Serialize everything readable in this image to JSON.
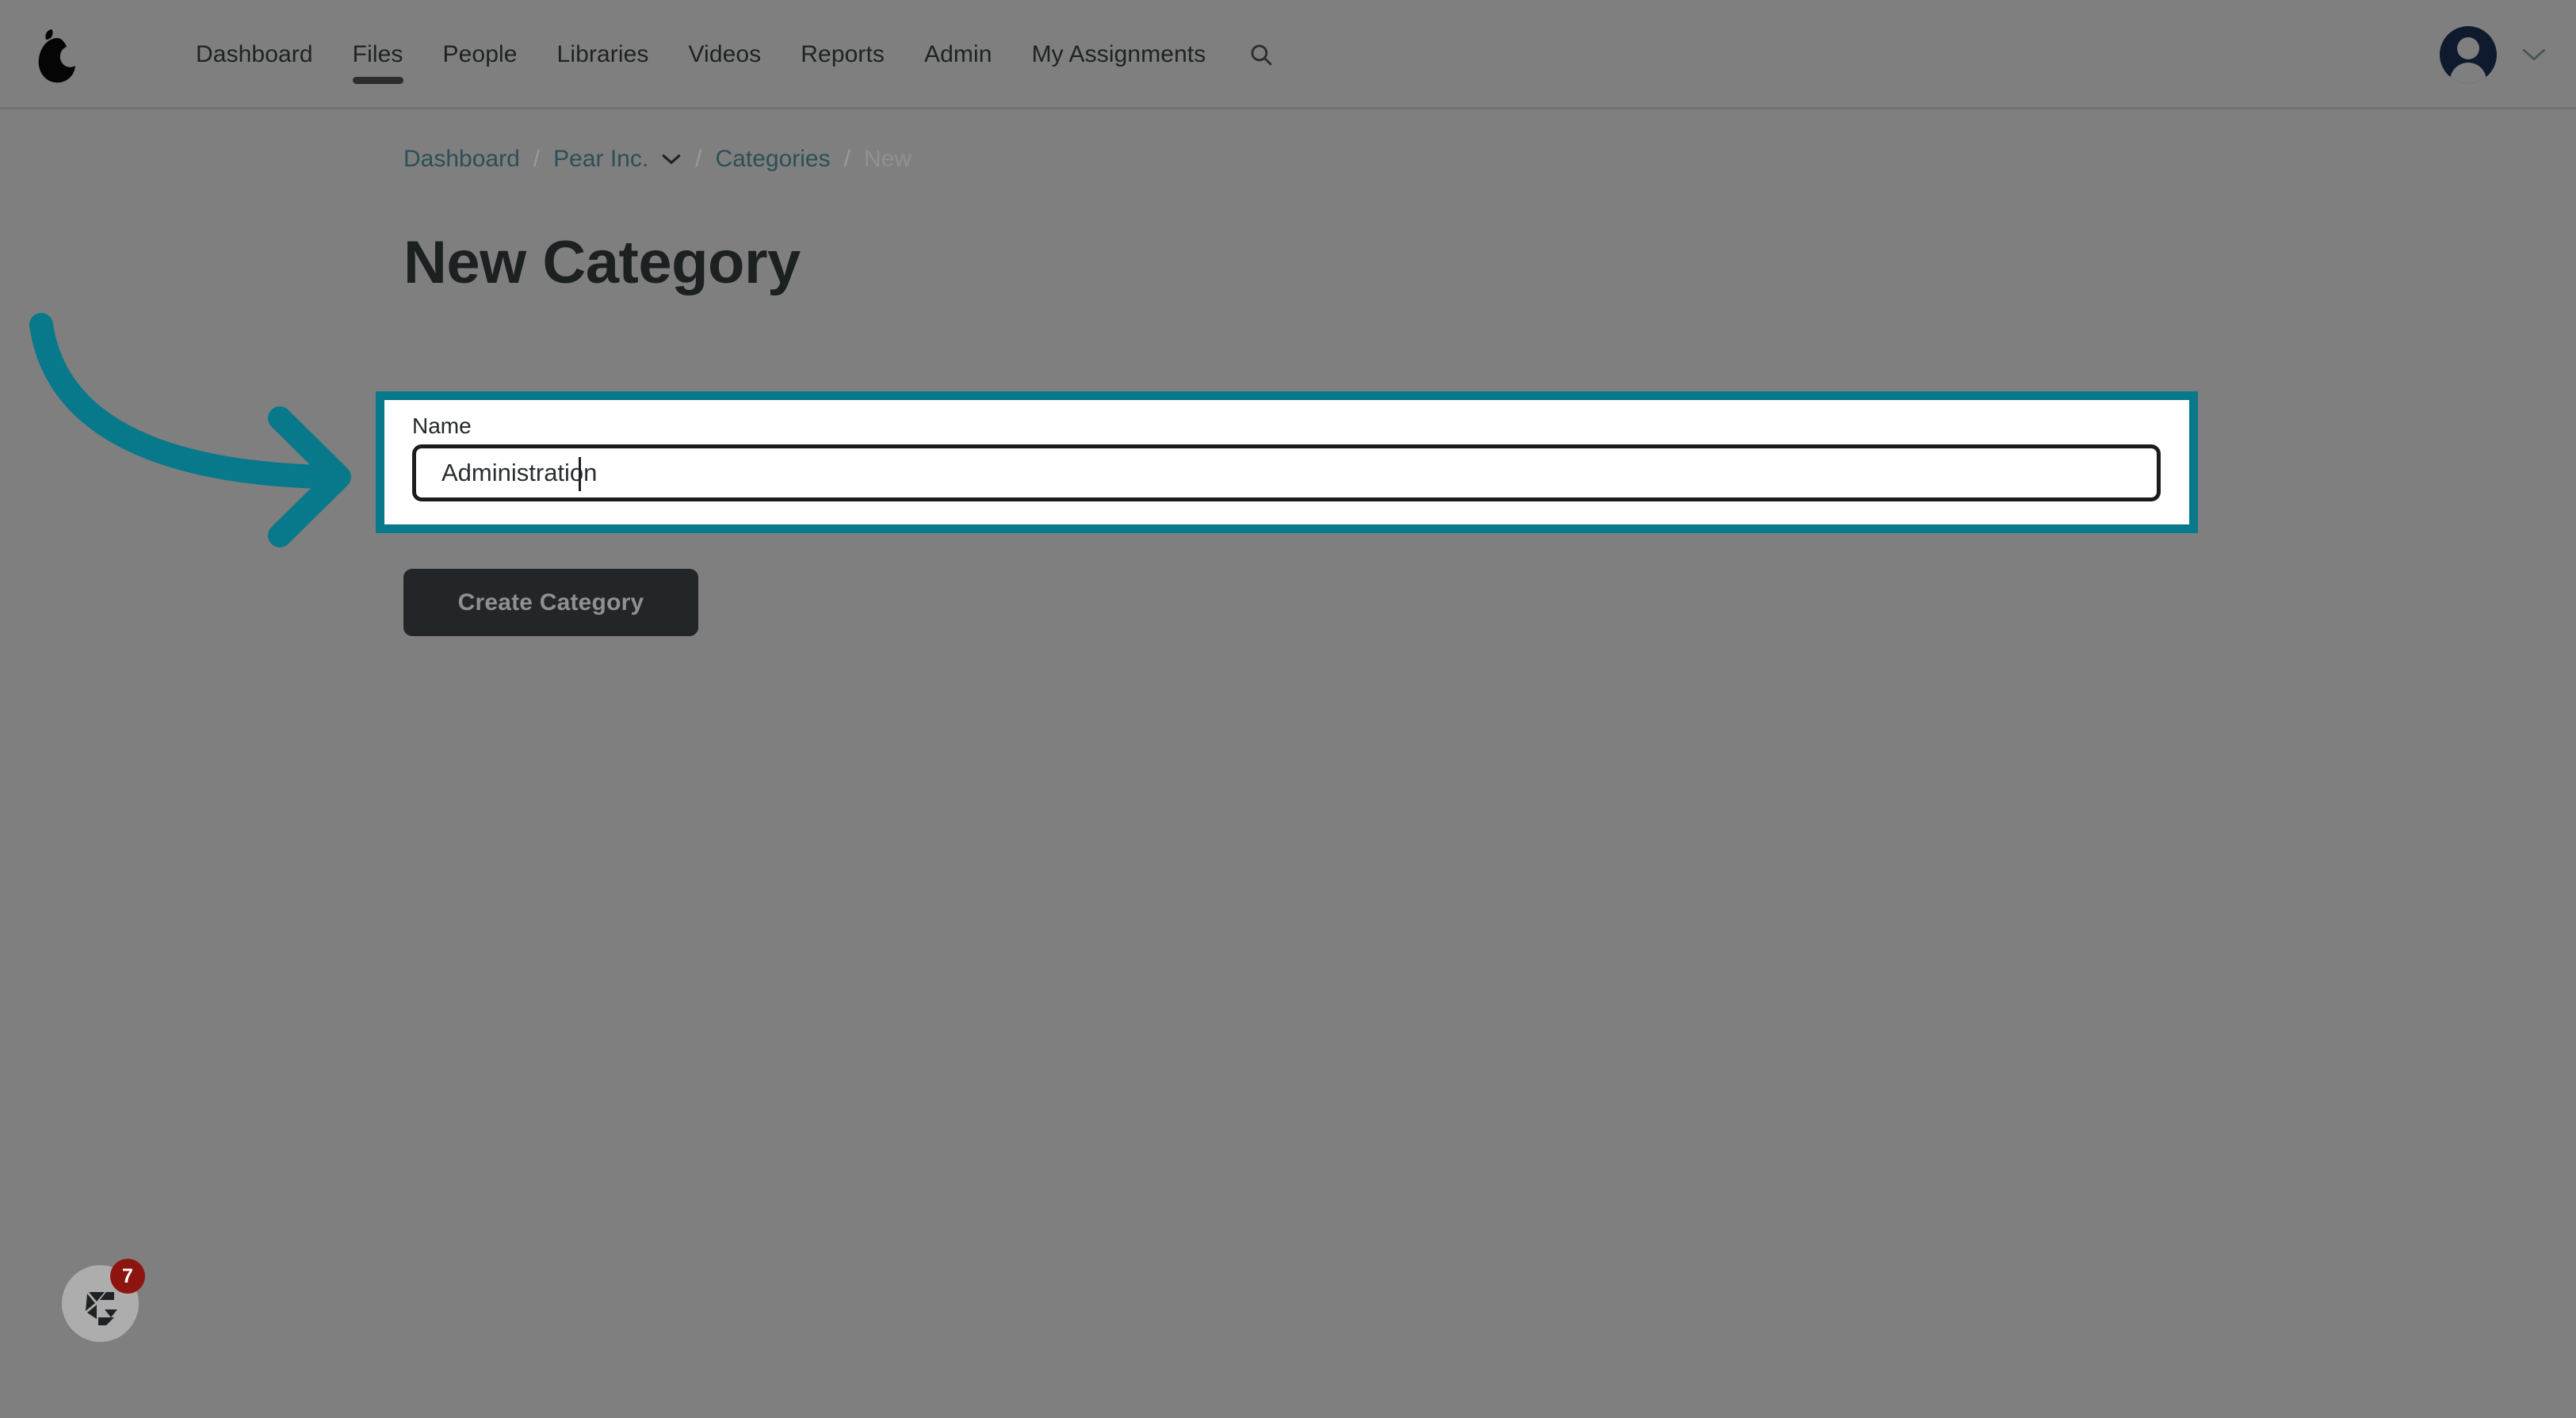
{
  "header": {
    "logo_icon": "pear-logo-icon",
    "nav_items": [
      {
        "label": "Dashboard",
        "active": false
      },
      {
        "label": "Files",
        "active": true
      },
      {
        "label": "People",
        "active": false
      },
      {
        "label": "Libraries",
        "active": false
      },
      {
        "label": "Videos",
        "active": false
      },
      {
        "label": "Reports",
        "active": false
      },
      {
        "label": "Admin",
        "active": false
      },
      {
        "label": "My Assignments",
        "active": false
      }
    ],
    "search_icon": "search-icon",
    "avatar_icon": "user-avatar-icon",
    "account_caret_icon": "chevron-down-icon"
  },
  "breadcrumb": {
    "items": [
      {
        "label": "Dashboard",
        "type": "link"
      },
      {
        "label": "Pear Inc.",
        "type": "link",
        "has_caret": true
      },
      {
        "label": "Categories",
        "type": "link"
      },
      {
        "label": "New",
        "type": "current"
      }
    ],
    "separator": "/"
  },
  "main": {
    "title": "New Category",
    "form": {
      "name_label": "Name",
      "name_value": "Administration",
      "name_placeholder": "",
      "submit_label": "Create Category"
    }
  },
  "annotation": {
    "arrow_icon": "curved-arrow-right-icon",
    "highlight_color": "#07798a"
  },
  "widget": {
    "icon": "chameleon-help-icon",
    "badge_count": "7"
  },
  "colors": {
    "accent_teal": "#07798a",
    "breadcrumb_link": "#2d4f56",
    "button_bg": "#232628",
    "badge_red": "#8e1410",
    "overlay_gray": "#7f7f7f"
  }
}
